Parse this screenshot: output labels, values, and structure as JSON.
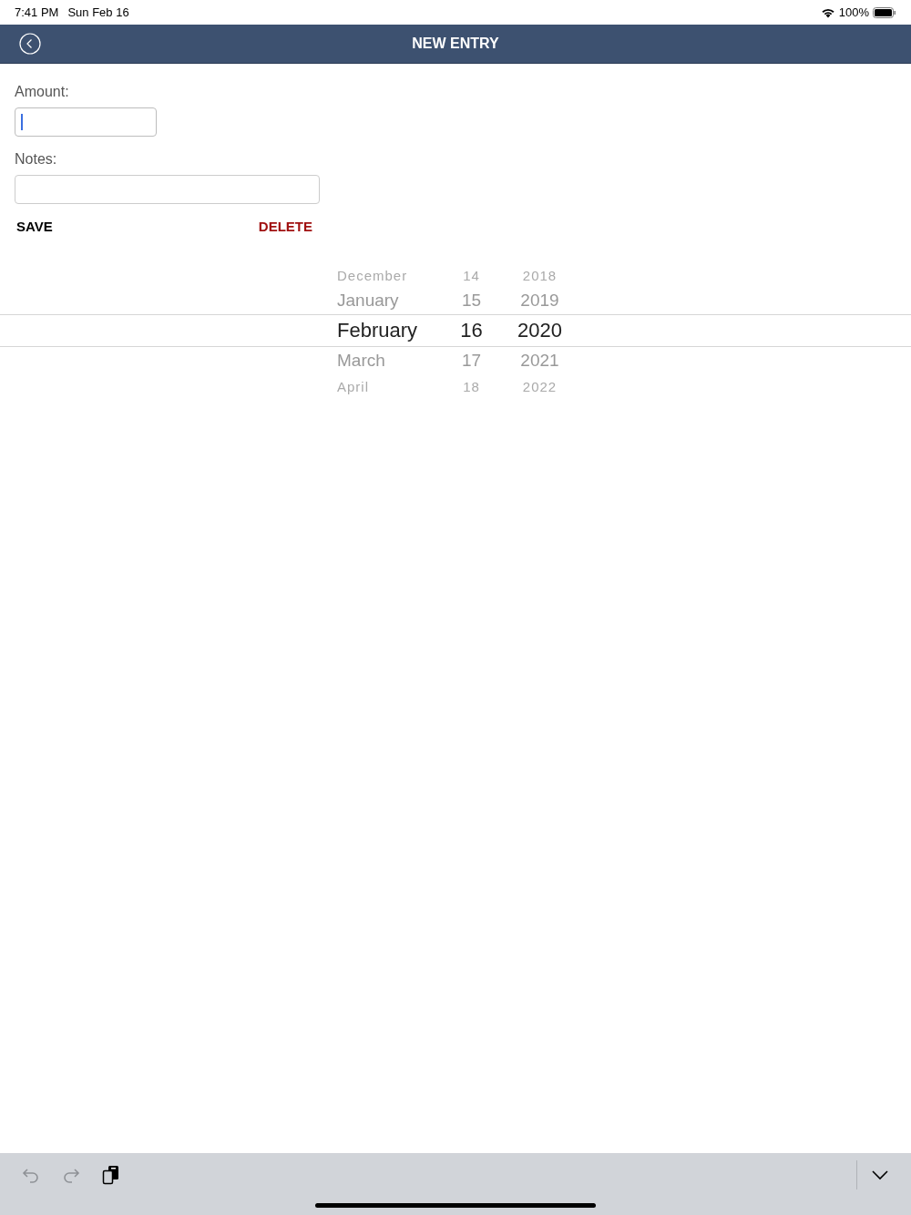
{
  "status_bar": {
    "time": "7:41 PM",
    "date": "Sun Feb 16",
    "battery": "100%"
  },
  "nav_bar": {
    "title": "NEW ENTRY"
  },
  "form": {
    "fields": [
      {
        "label": "Amount:",
        "focused": true,
        "wide": false
      },
      {
        "label": "Notes:",
        "focused": false,
        "wide": true
      }
    ],
    "save": "SAVE",
    "delete": "DELETE"
  },
  "date_picker": {
    "rows": [
      {
        "month": "December",
        "day": "14",
        "year": "2018",
        "selected": false
      },
      {
        "month": "January",
        "day": "15",
        "year": "2019",
        "selected": false
      },
      {
        "month": "February",
        "day": "16",
        "year": "2020",
        "selected": true
      },
      {
        "month": "March",
        "day": "17",
        "year": "2021",
        "selected": false
      },
      {
        "month": "April",
        "day": "18",
        "year": "2022",
        "selected": false
      }
    ]
  },
  "keyboard_bar": {
    "undo_enabled": false,
    "redo_enabled": false
  }
}
